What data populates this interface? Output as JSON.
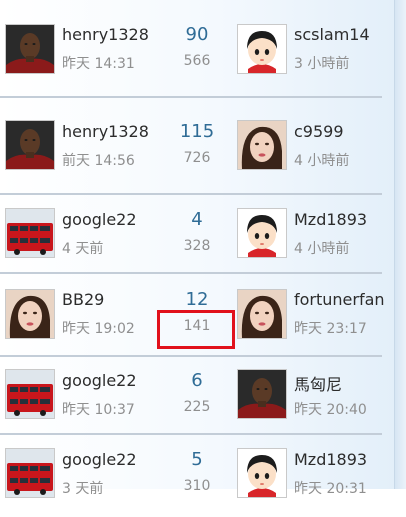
{
  "rows": [
    {
      "poster": {
        "avatar": "photo-avatar-man",
        "name": "henry1328",
        "time": "昨天 14:31"
      },
      "stats": {
        "replies": "90",
        "views": "566"
      },
      "last": {
        "avatar": "cartoon-girl-avatar",
        "name": "scslam14",
        "time": "3 小時前"
      }
    },
    {
      "poster": {
        "avatar": "photo-avatar-man",
        "name": "henry1328",
        "time": "前天 14:56"
      },
      "stats": {
        "replies": "115",
        "views": "726"
      },
      "last": {
        "avatar": "photo-avatar-woman",
        "name": "c9599",
        "time": "4 小時前"
      }
    },
    {
      "poster": {
        "avatar": "red-bus-avatar",
        "name": "google22",
        "time": "4 天前"
      },
      "stats": {
        "replies": "4",
        "views": "328"
      },
      "last": {
        "avatar": "cartoon-girl-avatar",
        "name": "Mzd1893",
        "time": "4 小時前"
      }
    },
    {
      "poster": {
        "avatar": "photo-avatar-woman",
        "name": "BB29",
        "time": "昨天 19:02"
      },
      "stats": {
        "replies": "12",
        "views": "141"
      },
      "last": {
        "avatar": "photo-avatar-woman",
        "name": "fortunerfan",
        "time": "昨天 23:17"
      }
    },
    {
      "poster": {
        "avatar": "red-bus-avatar",
        "name": "google22",
        "time": "昨天 10:37"
      },
      "stats": {
        "replies": "6",
        "views": "225"
      },
      "last": {
        "avatar": "photo-avatar-man",
        "name": "馬匈尼",
        "time": "昨天 20:40"
      }
    },
    {
      "poster": {
        "avatar": "red-bus-avatar",
        "name": "google22",
        "time": "3 天前"
      },
      "stats": {
        "replies": "5",
        "views": "310"
      },
      "last": {
        "avatar": "cartoon-girl-avatar",
        "name": "Mzd1893",
        "time": "昨天 20:31"
      }
    }
  ],
  "highlight": {
    "color": "#e1111c"
  },
  "colors": {
    "reply_count": "#2f6c96",
    "meta_text": "#8f8f8f",
    "name_text": "#2c2c2c",
    "separator": "#c3cdd8"
  }
}
